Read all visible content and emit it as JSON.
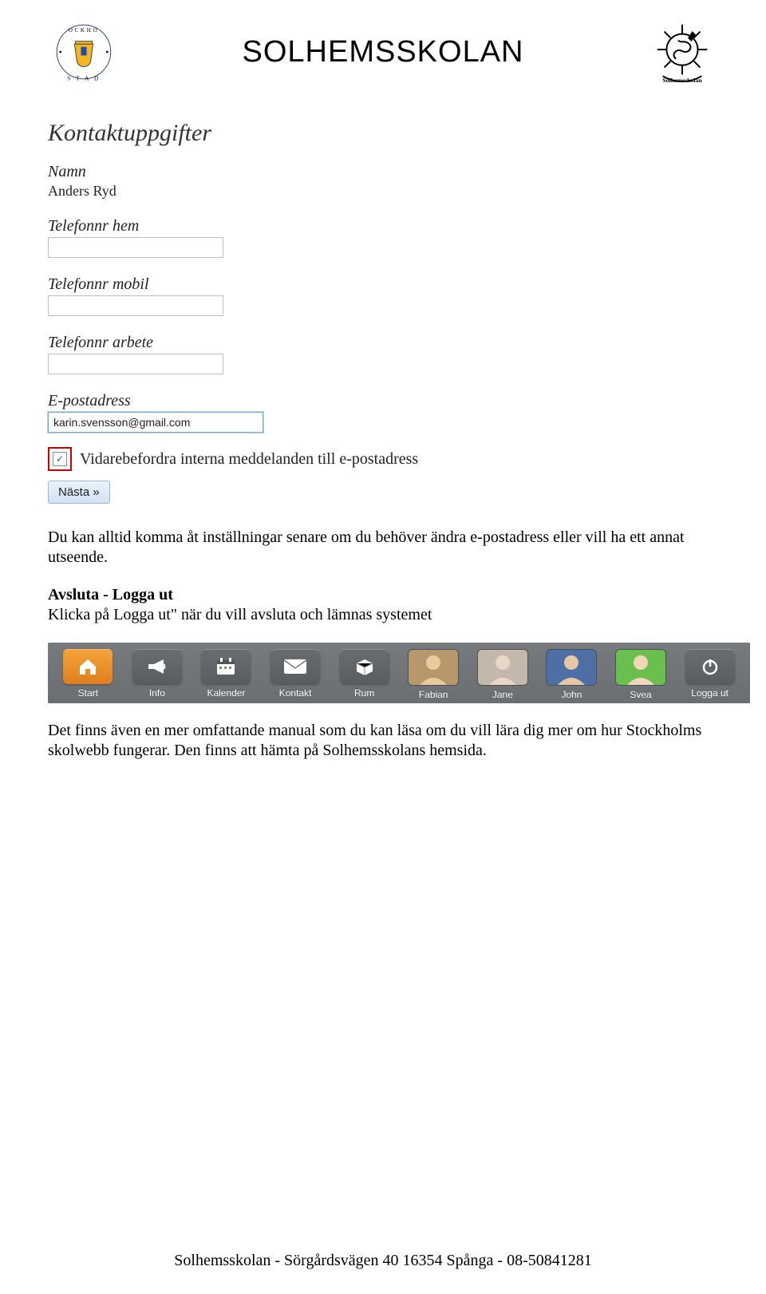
{
  "header": {
    "title": "SOLHEMSSKOLAN",
    "logo_left_alt": "Stockholms Stad",
    "logo_right_alt": "Solhemsskolan"
  },
  "form": {
    "title": "Kontaktuppgifter",
    "name_label": "Namn",
    "name_value": "Anders Ryd",
    "phone_home_label": "Telefonnr hem",
    "phone_home_value": "",
    "phone_mobile_label": "Telefonnr mobil",
    "phone_mobile_value": "",
    "phone_work_label": "Telefonnr arbete",
    "phone_work_value": "",
    "email_label": "E-postadress",
    "email_value": "karin.svensson@gmail.com",
    "forward_checked": true,
    "forward_label": "Vidarebefordra interna meddelanden till e-postadress",
    "next_button": "Nästa »"
  },
  "body": {
    "p1": "Du kan alltid komma åt inställningar senare om du behöver ändra e-postadress eller vill ha ett annat utseende.",
    "h2": "Avsluta - Logga ut",
    "p2": "Klicka på Logga ut\" när du vill avsluta och lämnas systemet",
    "p3": "Det finns även en mer omfattande manual som du kan läsa om du vill lära dig mer om hur Stockholms skolwebb fungerar. Den finns att hämta på Solhemsskolans hemsida."
  },
  "toolbar": {
    "items": [
      {
        "label": "Start",
        "icon": "home",
        "active": true,
        "type": "glyph"
      },
      {
        "label": "Info",
        "icon": "megaphone",
        "active": false,
        "type": "glyph"
      },
      {
        "label": "Kalender",
        "icon": "calendar",
        "active": false,
        "type": "glyph"
      },
      {
        "label": "Kontakt",
        "icon": "mail",
        "active": false,
        "type": "glyph"
      },
      {
        "label": "Rum",
        "icon": "box",
        "active": false,
        "type": "glyph"
      },
      {
        "label": "Fabian",
        "icon": "avatar1",
        "active": false,
        "type": "avatar"
      },
      {
        "label": "Jane",
        "icon": "avatar2",
        "active": false,
        "type": "avatar"
      },
      {
        "label": "John",
        "icon": "avatar3",
        "active": false,
        "type": "avatar"
      },
      {
        "label": "Svea",
        "icon": "avatar4",
        "active": false,
        "type": "avatar"
      },
      {
        "label": "Logga ut",
        "icon": "power",
        "active": false,
        "type": "glyph"
      }
    ]
  },
  "footer": {
    "text": "Solhemsskolan  -  Sörgårdsvägen 40  16354 Spånga  -  08-50841281"
  }
}
